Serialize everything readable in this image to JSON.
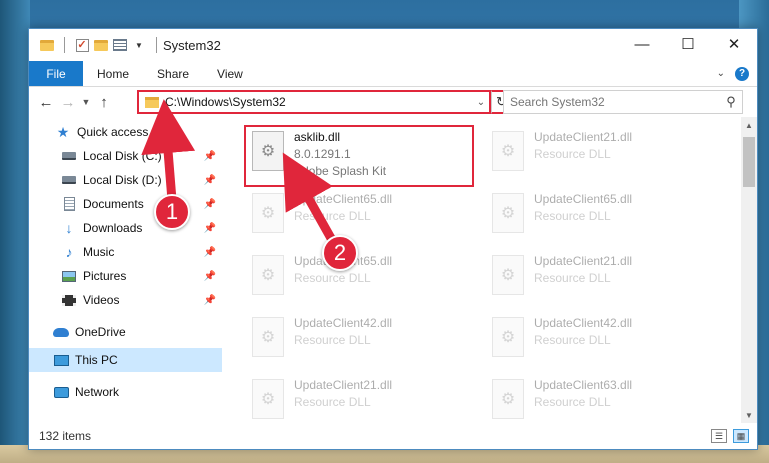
{
  "window": {
    "title": "System32",
    "controls": {
      "minimize": "—",
      "maximize": "☐",
      "close": "✕"
    }
  },
  "ribbon": {
    "tabs": [
      "File",
      "Home",
      "Share",
      "View"
    ],
    "help": "?"
  },
  "address": {
    "path": "C:\\Windows\\System32",
    "search_placeholder": "Search System32"
  },
  "sidebar": {
    "items": [
      {
        "label": "Quick access",
        "icon": "star-icon",
        "pinned": false
      },
      {
        "label": "Local Disk (C:)",
        "icon": "drive-icon",
        "pinned": true
      },
      {
        "label": "Local Disk (D:)",
        "icon": "drive-icon",
        "pinned": true
      },
      {
        "label": "Documents",
        "icon": "documents-icon",
        "pinned": true
      },
      {
        "label": "Downloads",
        "icon": "downloads-icon",
        "pinned": true
      },
      {
        "label": "Music",
        "icon": "music-icon",
        "pinned": true
      },
      {
        "label": "Pictures",
        "icon": "pictures-icon",
        "pinned": true
      },
      {
        "label": "Videos",
        "icon": "videos-icon",
        "pinned": true
      },
      {
        "label": "OneDrive",
        "icon": "onedrive-icon",
        "pinned": false
      },
      {
        "label": "This PC",
        "icon": "this-pc-icon",
        "pinned": false,
        "selected": true
      },
      {
        "label": "Network",
        "icon": "network-icon",
        "pinned": false
      }
    ]
  },
  "files": {
    "highlighted": {
      "name": "asklib.dll",
      "version": "8.0.1291.1",
      "description": "Adobe Splash Kit"
    },
    "left_column": [
      {
        "name": "UpdateClient65.dll",
        "description": "Resource DLL"
      },
      {
        "name": "UpdateClient65.dll",
        "description": "Resource DLL"
      },
      {
        "name": "UpdateClient42.dll",
        "description": "Resource DLL"
      },
      {
        "name": "UpdateClient21.dll",
        "description": "Resource DLL"
      }
    ],
    "right_column": [
      {
        "name": "UpdateClient21.dll",
        "description": "Resource DLL"
      },
      {
        "name": "UpdateClient65.dll",
        "description": "Resource DLL"
      },
      {
        "name": "UpdateClient21.dll",
        "description": "Resource DLL"
      },
      {
        "name": "UpdateClient42.dll",
        "description": "Resource DLL"
      },
      {
        "name": "UpdateClient63.dll",
        "description": "Resource DLL"
      }
    ]
  },
  "status": {
    "item_count": "132 items"
  },
  "callouts": {
    "one": "1",
    "two": "2"
  },
  "colors": {
    "accent": "#1979ca",
    "highlight": "#e0263b",
    "selected_bg": "#cce8ff"
  }
}
